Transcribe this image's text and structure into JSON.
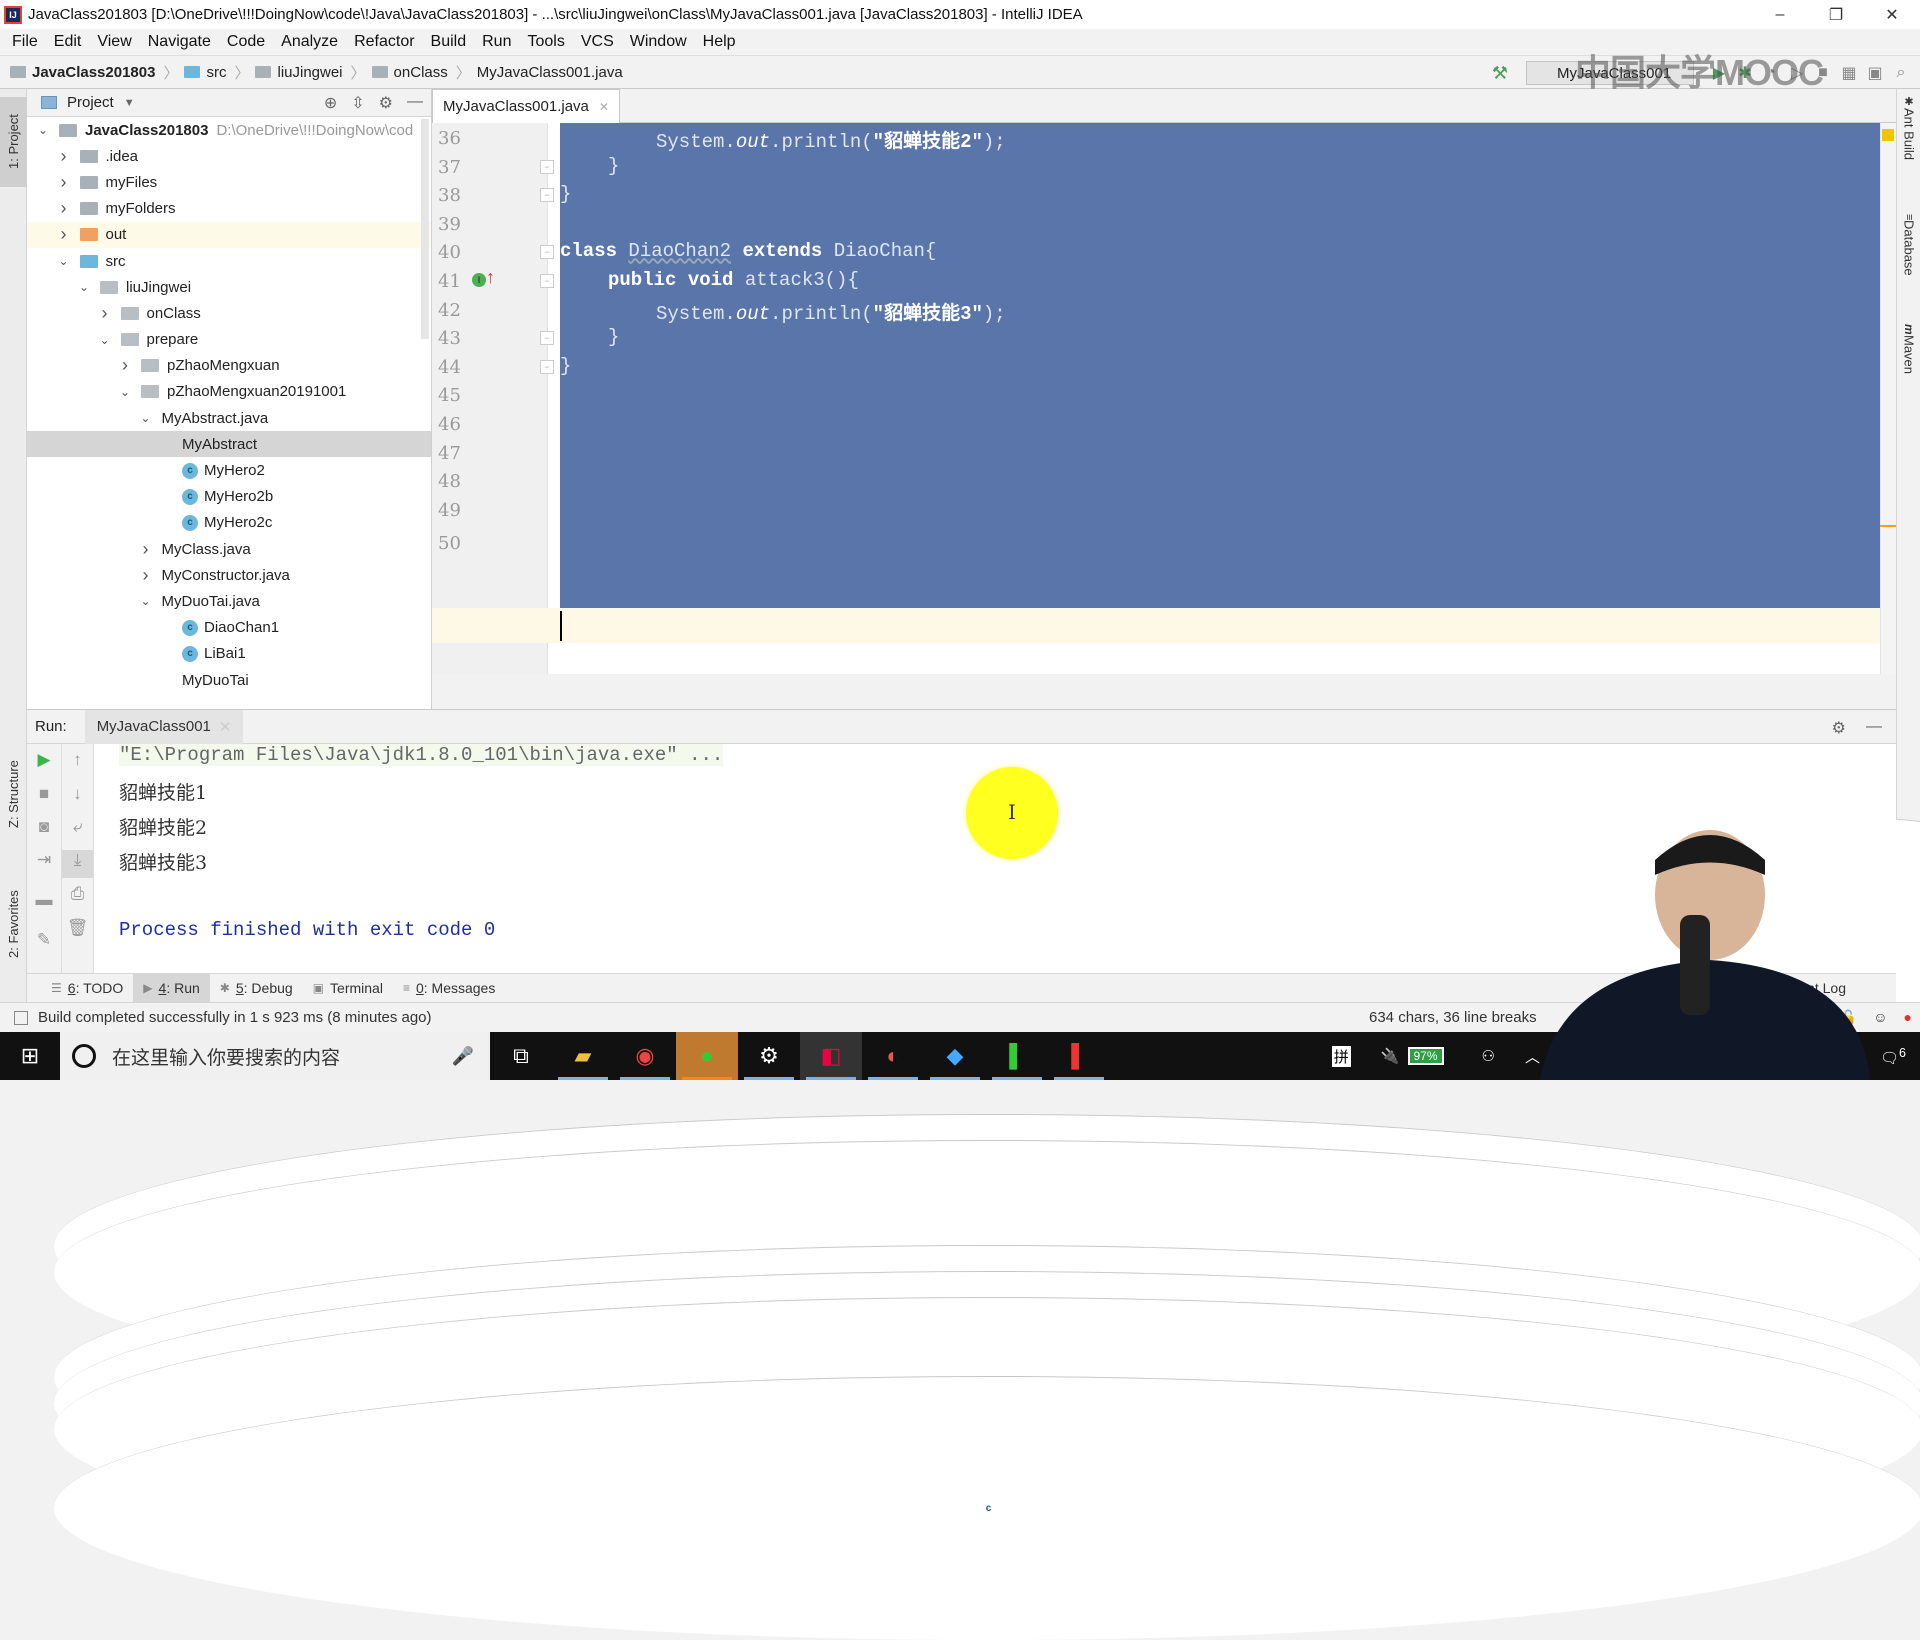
{
  "window": {
    "title": "JavaClass201803 [D:\\OneDrive\\!!!DoingNow\\code\\!Java\\JavaClass201803] - ...\\src\\liuJingwei\\onClass\\MyJavaClass001.java [JavaClass201803] - IntelliJ IDEA",
    "controls": {
      "minimize": "–",
      "restore": "❐",
      "close": "✕"
    }
  },
  "menu": [
    "File",
    "Edit",
    "View",
    "Navigate",
    "Code",
    "Analyze",
    "Refactor",
    "Build",
    "Run",
    "Tools",
    "VCS",
    "Window",
    "Help"
  ],
  "breadcrumb": [
    "JavaClass201803",
    "src",
    "liuJingwei",
    "onClass",
    "MyJavaClass001.java"
  ],
  "toolbar": {
    "run_config": "MyJavaClass001",
    "watermark": "中国大学MOOC"
  },
  "left_strip": {
    "project_tab": "1: Project",
    "structure_tab": "Z: Structure",
    "favorites_tab": "2: Favorites"
  },
  "right_strip": [
    "Ant Build",
    "Database",
    "Maven"
  ],
  "project": {
    "header": "Project",
    "tree": [
      {
        "label": "JavaClass201803",
        "path": "D:\\OneDrive\\!!!DoingNow\\cod",
        "depth": 0,
        "expanded": true,
        "type": "module"
      },
      {
        "label": ".idea",
        "depth": 1,
        "expanded": false,
        "type": "folder"
      },
      {
        "label": "myFiles",
        "depth": 1,
        "expanded": false,
        "type": "folder"
      },
      {
        "label": "myFolders",
        "depth": 1,
        "expanded": false,
        "type": "folder"
      },
      {
        "label": "out",
        "depth": 1,
        "expanded": false,
        "type": "folder-excluded"
      },
      {
        "label": "src",
        "depth": 1,
        "expanded": true,
        "type": "folder-src"
      },
      {
        "label": "liuJingwei",
        "depth": 2,
        "expanded": true,
        "type": "package"
      },
      {
        "label": "onClass",
        "depth": 3,
        "expanded": false,
        "type": "package"
      },
      {
        "label": "prepare",
        "depth": 3,
        "expanded": true,
        "type": "package"
      },
      {
        "label": "pZhaoMengxuan",
        "depth": 4,
        "expanded": false,
        "type": "package"
      },
      {
        "label": "pZhaoMengxuan20191001",
        "depth": 4,
        "expanded": true,
        "type": "package"
      },
      {
        "label": "MyAbstract.java",
        "depth": 5,
        "expanded": true,
        "type": "java-file"
      },
      {
        "label": "MyAbstract",
        "depth": 6,
        "type": "class-run"
      },
      {
        "label": "MyHero2",
        "depth": 6,
        "type": "abstract-class"
      },
      {
        "label": "MyHero2b",
        "depth": 6,
        "type": "abstract-class"
      },
      {
        "label": "MyHero2c",
        "depth": 6,
        "type": "class"
      },
      {
        "label": "MyClass.java",
        "depth": 5,
        "expanded": false,
        "type": "java-file"
      },
      {
        "label": "MyConstructor.java",
        "depth": 5,
        "expanded": false,
        "type": "java-file"
      },
      {
        "label": "MyDuoTai.java",
        "depth": 5,
        "expanded": true,
        "type": "java-file"
      },
      {
        "label": "DiaoChan1",
        "depth": 6,
        "type": "class"
      },
      {
        "label": "LiBai1",
        "depth": 6,
        "type": "class"
      },
      {
        "label": "MyDuoTai",
        "depth": 6,
        "type": "class-run"
      }
    ]
  },
  "editor": {
    "tab": "MyJavaClass001.java",
    "lines": [
      {
        "n": "36",
        "code": "        System.out.println(\"貂蝉技能2\");"
      },
      {
        "n": "37",
        "code": "    }"
      },
      {
        "n": "38",
        "code": "}"
      },
      {
        "n": "39",
        "code": ""
      },
      {
        "n": "40",
        "code": "class DiaoChan2 extends DiaoChan{"
      },
      {
        "n": "41",
        "code": "    public void attack3(){"
      },
      {
        "n": "42",
        "code": "        System.out.println(\"貂蝉技能3\");"
      },
      {
        "n": "43",
        "code": "    }"
      },
      {
        "n": "44",
        "code": "}"
      },
      {
        "n": "45",
        "code": ""
      },
      {
        "n": "46",
        "code": ""
      },
      {
        "n": "47",
        "code": ""
      },
      {
        "n": "48",
        "code": ""
      },
      {
        "n": "49",
        "code": ""
      },
      {
        "n": "50",
        "code": ""
      }
    ],
    "tokens": {
      "system": "System.",
      "out": "out",
      "println": ".println(",
      "str2": "\"貂蝉技能2\"",
      "str3": "\"貂蝉技能3\"",
      "end": ");",
      "brace_close": "}",
      "kw_class": "class",
      "cls_name": "DiaoChan2",
      "kw_extends": "extends",
      "parent": "DiaoChan{",
      "kw_public": "public",
      "kw_void": "void",
      "method": "attack3(){"
    },
    "gutter_badge": "I",
    "selection_color": "#5a75aa"
  },
  "run": {
    "label": "Run:",
    "tab": "MyJavaClass001",
    "output": [
      "\"E:\\Program Files\\Java\\jdk1.8.0_101\\bin\\java.exe\" ...",
      "貂蝉技能1",
      "貂蝉技能2",
      "貂蝉技能3",
      "",
      "Process finished with exit code 0"
    ]
  },
  "tool_windows": [
    {
      "key": "6",
      "label": ": TODO"
    },
    {
      "key": "4",
      "label": ": Run",
      "selected": true
    },
    {
      "key": "5",
      "label": ": Debug"
    },
    {
      "key": "",
      "label": "Terminal"
    },
    {
      "key": "0",
      "label": ": Messages"
    }
  ],
  "event_log": "Event Log",
  "status": {
    "message": "Build completed successfully in 1 s 923 ms (8 minutes ago)",
    "info": "634 chars, 36 line breaks"
  },
  "taskbar": {
    "search_placeholder": "在这里输入你要搜索的内容",
    "ime": "拼",
    "battery": "97%",
    "notifications": "6"
  }
}
